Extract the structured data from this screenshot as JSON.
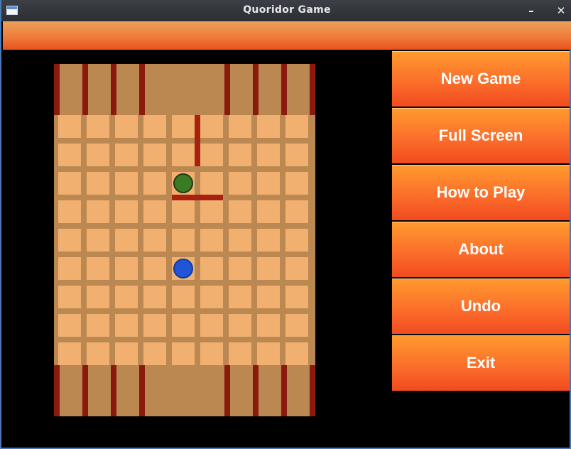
{
  "window": {
    "title": "Quoridor Game"
  },
  "controls": {
    "minimize": "–",
    "close": "✕"
  },
  "menu": [
    "New Game",
    "Full Screen",
    "How to Play",
    "About",
    "Undo",
    "Exit"
  ],
  "board": {
    "size": 9,
    "home_stripe_lines": [
      0,
      1,
      2,
      3,
      6,
      7,
      8,
      9
    ],
    "walls": [
      {
        "orientation": "vertical",
        "after_col": 4,
        "row": 0
      },
      {
        "orientation": "horizontal",
        "after_row": 2,
        "col": 4
      }
    ],
    "pawns": [
      {
        "name": "green-pawn",
        "color": "#3a7a25",
        "row": 2,
        "col": 4
      },
      {
        "name": "blue-pawn",
        "color": "#1f55d6",
        "row": 5,
        "col": 4
      }
    ]
  }
}
